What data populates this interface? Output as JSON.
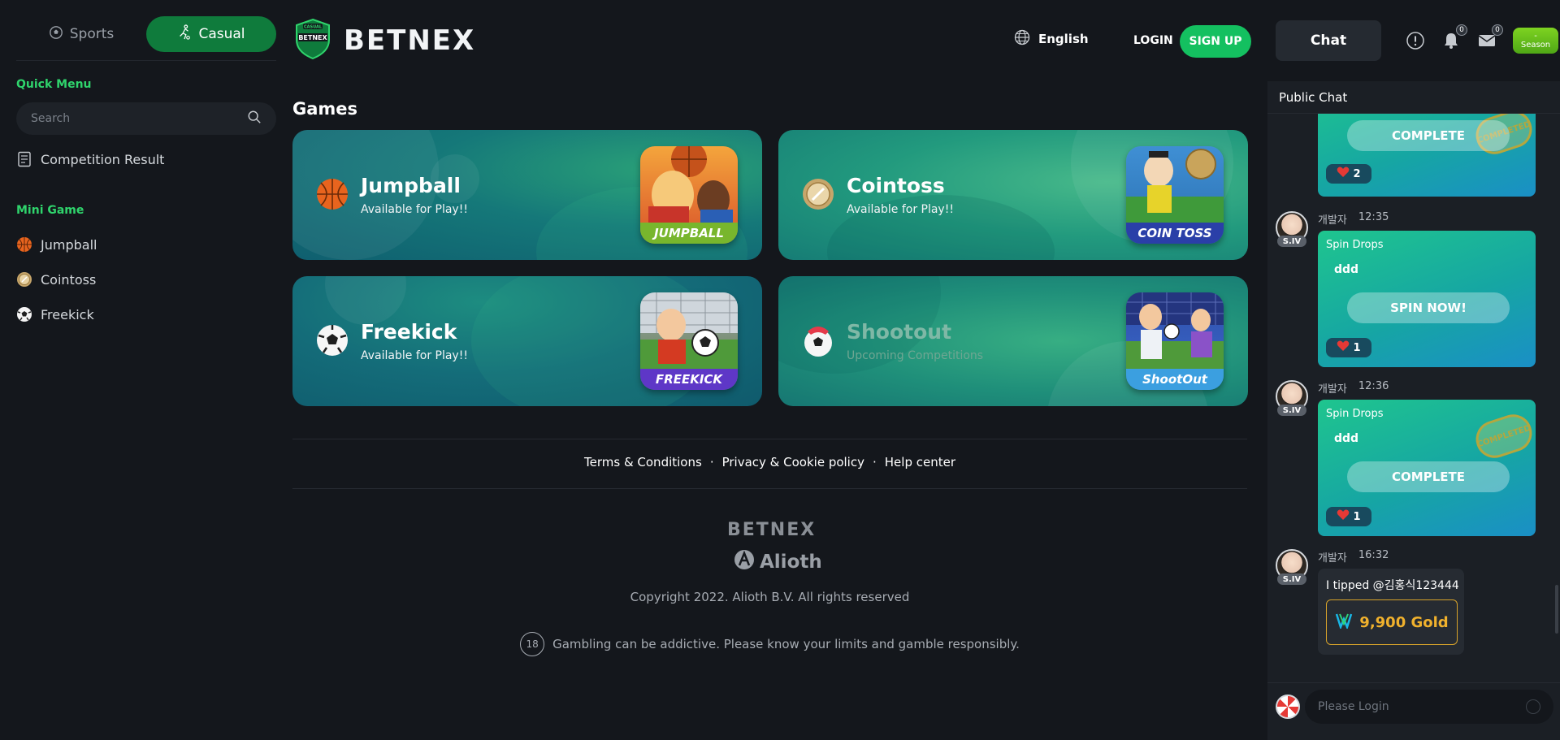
{
  "sidebar": {
    "mode_sports": "Sports",
    "mode_casual": "Casual",
    "quick_menu_heading": "Quick Menu",
    "search_placeholder": "Search",
    "competition_result": "Competition Result",
    "mini_game_heading": "Mini Game",
    "mini_games": [
      "Jumpball",
      "Cointoss",
      "Freekick"
    ]
  },
  "header": {
    "logo": "BETNEX",
    "logo_badge_top": "CASUAL",
    "logo_badge": "BETNEX",
    "language": "English",
    "login": "LOGIN",
    "signup": "SIGN UP",
    "chat_tab": "Chat",
    "notification_count": "0",
    "mail_count": "0",
    "season_line1": "-",
    "season_line2": "Season"
  },
  "games": {
    "title": "Games",
    "cards": [
      {
        "name": "Jumpball",
        "status": "Available for Play!!",
        "thumb_label": "JUMPBALL",
        "available": true
      },
      {
        "name": "Cointoss",
        "status": "Available for Play!!",
        "thumb_label": "COIN TOSS",
        "available": true
      },
      {
        "name": "Freekick",
        "status": "Available for Play!!",
        "thumb_label": "FREEKICK",
        "available": true
      },
      {
        "name": "Shootout",
        "status": "Upcoming Competitions",
        "thumb_label": "ShootOut",
        "available": false
      }
    ]
  },
  "footer": {
    "links": [
      "Terms & Conditions",
      "Privacy & Cookie policy",
      "Help center"
    ],
    "separator": "·",
    "logo": "BETNEX",
    "company": "Alioth",
    "copyright": "Copyright 2022. Alioth B.V. All rights reserved",
    "age": "18",
    "responsible": "Gambling can be addictive. Please know your limits and gamble responsibly."
  },
  "chat": {
    "header": "Public Chat",
    "input_placeholder": "Please Login",
    "messages": [
      {
        "type": "drop",
        "action": "COMPLETE",
        "likes": "2",
        "stamp": "COMPLETED"
      },
      {
        "user": "개발자",
        "time": "12:35",
        "tag": "S.IV",
        "title": "Spin Drops",
        "body": "ddd",
        "action": "SPIN NOW!",
        "likes": "1"
      },
      {
        "user": "개발자",
        "time": "12:36",
        "tag": "S.IV",
        "title": "Spin Drops",
        "body": "ddd",
        "action": "COMPLETE",
        "likes": "1",
        "stamp": "COMPLETED"
      },
      {
        "user": "개발자",
        "time": "16:32",
        "tag": "S.IV",
        "text": "I tipped @김홍식123444",
        "amount": "9,900 Gold"
      }
    ]
  },
  "colors": {
    "accent": "#14c060",
    "gold": "#f0b12d",
    "background": "#14171c"
  }
}
